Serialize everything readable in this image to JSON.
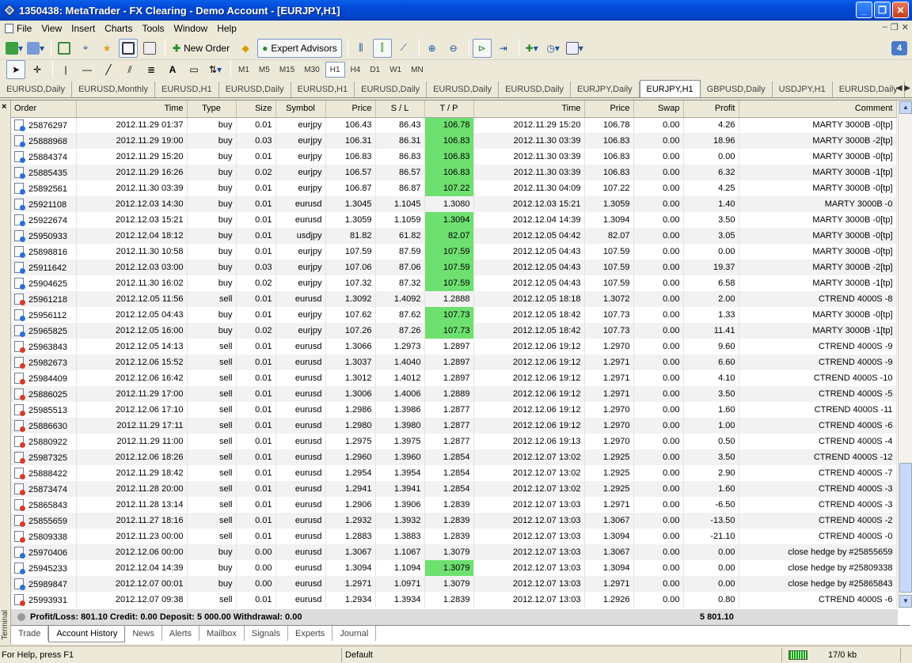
{
  "window": {
    "title": "1350438: MetaTrader - FX Clearing - Demo Account - [EURJPY,H1]"
  },
  "menu": [
    "File",
    "View",
    "Insert",
    "Charts",
    "Tools",
    "Window",
    "Help"
  ],
  "toolbar": {
    "new_order": "New Order",
    "expert_advisors": "Expert Advisors",
    "help_badge": "4"
  },
  "timeframes": [
    "M1",
    "M5",
    "M15",
    "M30",
    "H1",
    "H4",
    "D1",
    "W1",
    "MN"
  ],
  "active_timeframe": "H1",
  "chart_tabs": [
    "EURUSD,Daily",
    "EURUSD,Monthly",
    "EURUSD,H1",
    "EURUSD,Daily",
    "EURUSD,H1",
    "EURUSD,Daily",
    "EURUSD,Daily",
    "EURUSD,Daily",
    "EURJPY,Daily",
    "EURJPY,H1",
    "GBPUSD,Daily",
    "USDJPY,H1",
    "EURUSD,Daily"
  ],
  "active_chart_tab": "EURJPY,H1",
  "columns": [
    "Order",
    "Time",
    "Type",
    "Size",
    "Symbol",
    "Price",
    "S / L",
    "T / P",
    "Time",
    "Price",
    "Swap",
    "Profit",
    "Comment"
  ],
  "tp_highlight_color": "#6ee070",
  "rows": [
    [
      "25876297",
      "2012.11.29 01:37",
      "buy",
      "0.01",
      "eurjpy",
      "106.43",
      "86.43",
      "106.78",
      "2012.11.29 15:20",
      "106.78",
      "0.00",
      "4.26",
      "MARTY 3000B -0[tp]",
      1
    ],
    [
      "25888968",
      "2012.11.29 19:00",
      "buy",
      "0.03",
      "eurjpy",
      "106.31",
      "86.31",
      "106.83",
      "2012.11.30 03:39",
      "106.83",
      "0.00",
      "18.96",
      "MARTY 3000B -2[tp]",
      1
    ],
    [
      "25884374",
      "2012.11.29 15:20",
      "buy",
      "0.01",
      "eurjpy",
      "106.83",
      "86.83",
      "106.83",
      "2012.11.30 03:39",
      "106.83",
      "0.00",
      "0.00",
      "MARTY 3000B -0[tp]",
      1
    ],
    [
      "25885435",
      "2012.11.29 16:26",
      "buy",
      "0.02",
      "eurjpy",
      "106.57",
      "86.57",
      "106.83",
      "2012.11.30 03:39",
      "106.83",
      "0.00",
      "6.32",
      "MARTY 3000B -1[tp]",
      1
    ],
    [
      "25892561",
      "2012.11.30 03:39",
      "buy",
      "0.01",
      "eurjpy",
      "106.87",
      "86.87",
      "107.22",
      "2012.11.30 04:09",
      "107.22",
      "0.00",
      "4.25",
      "MARTY 3000B -0[tp]",
      1
    ],
    [
      "25921108",
      "2012.12.03 14:30",
      "buy",
      "0.01",
      "eurusd",
      "1.3045",
      "1.1045",
      "1.3080",
      "2012.12.03 15:21",
      "1.3059",
      "0.00",
      "1.40",
      "MARTY 3000B -0",
      0
    ],
    [
      "25922674",
      "2012.12.03 15:21",
      "buy",
      "0.01",
      "eurusd",
      "1.3059",
      "1.1059",
      "1.3094",
      "2012.12.04 14:39",
      "1.3094",
      "0.00",
      "3.50",
      "MARTY 3000B -0[tp]",
      1
    ],
    [
      "25950933",
      "2012.12.04 18:12",
      "buy",
      "0.01",
      "usdjpy",
      "81.82",
      "61.82",
      "82.07",
      "2012.12.05 04:42",
      "82.07",
      "0.00",
      "3.05",
      "MARTY 3000B -0[tp]",
      1
    ],
    [
      "25898816",
      "2012.11.30 10:58",
      "buy",
      "0.01",
      "eurjpy",
      "107.59",
      "87.59",
      "107.59",
      "2012.12.05 04:43",
      "107.59",
      "0.00",
      "0.00",
      "MARTY 3000B -0[tp]",
      1
    ],
    [
      "25911642",
      "2012.12.03 03:00",
      "buy",
      "0.03",
      "eurjpy",
      "107.06",
      "87.06",
      "107.59",
      "2012.12.05 04:43",
      "107.59",
      "0.00",
      "19.37",
      "MARTY 3000B -2[tp]",
      1
    ],
    [
      "25904625",
      "2012.11.30 16:02",
      "buy",
      "0.02",
      "eurjpy",
      "107.32",
      "87.32",
      "107.59",
      "2012.12.05 04:43",
      "107.59",
      "0.00",
      "6.58",
      "MARTY 3000B -1[tp]",
      1
    ],
    [
      "25961218",
      "2012.12.05 11:56",
      "sell",
      "0.01",
      "eurusd",
      "1.3092",
      "1.4092",
      "1.2888",
      "2012.12.05 18:18",
      "1.3072",
      "0.00",
      "2.00",
      "CTREND 4000S -8",
      0
    ],
    [
      "25956112",
      "2012.12.05 04:43",
      "buy",
      "0.01",
      "eurjpy",
      "107.62",
      "87.62",
      "107.73",
      "2012.12.05 18:42",
      "107.73",
      "0.00",
      "1.33",
      "MARTY 3000B -0[tp]",
      1
    ],
    [
      "25965825",
      "2012.12.05 16:00",
      "buy",
      "0.02",
      "eurjpy",
      "107.26",
      "87.26",
      "107.73",
      "2012.12.05 18:42",
      "107.73",
      "0.00",
      "11.41",
      "MARTY 3000B -1[tp]",
      1
    ],
    [
      "25963843",
      "2012.12.05 14:13",
      "sell",
      "0.01",
      "eurusd",
      "1.3066",
      "1.2973",
      "1.2897",
      "2012.12.06 19:12",
      "1.2970",
      "0.00",
      "9.60",
      "CTREND 4000S -9",
      0
    ],
    [
      "25982673",
      "2012.12.06 15:52",
      "sell",
      "0.01",
      "eurusd",
      "1.3037",
      "1.4040",
      "1.2897",
      "2012.12.06 19:12",
      "1.2971",
      "0.00",
      "6.60",
      "CTREND 4000S -9",
      0
    ],
    [
      "25984409",
      "2012.12.06 16:42",
      "sell",
      "0.01",
      "eurusd",
      "1.3012",
      "1.4012",
      "1.2897",
      "2012.12.06 19:12",
      "1.2971",
      "0.00",
      "4.10",
      "CTREND 4000S -10",
      0
    ],
    [
      "25886025",
      "2012.11.29 17:00",
      "sell",
      "0.01",
      "eurusd",
      "1.3006",
      "1.4006",
      "1.2889",
      "2012.12.06 19:12",
      "1.2971",
      "0.00",
      "3.50",
      "CTREND 4000S -5",
      0
    ],
    [
      "25985513",
      "2012.12.06 17:10",
      "sell",
      "0.01",
      "eurusd",
      "1.2986",
      "1.3986",
      "1.2877",
      "2012.12.06 19:12",
      "1.2970",
      "0.00",
      "1.60",
      "CTREND 4000S -11",
      0
    ],
    [
      "25886630",
      "2012.11.29 17:11",
      "sell",
      "0.01",
      "eurusd",
      "1.2980",
      "1.3980",
      "1.2877",
      "2012.12.06 19:12",
      "1.2970",
      "0.00",
      "1.00",
      "CTREND 4000S -6",
      0
    ],
    [
      "25880922",
      "2012.11.29 11:00",
      "sell",
      "0.01",
      "eurusd",
      "1.2975",
      "1.3975",
      "1.2877",
      "2012.12.06 19:13",
      "1.2970",
      "0.00",
      "0.50",
      "CTREND 4000S -4",
      0
    ],
    [
      "25987325",
      "2012.12.06 18:26",
      "sell",
      "0.01",
      "eurusd",
      "1.2960",
      "1.3960",
      "1.2854",
      "2012.12.07 13:02",
      "1.2925",
      "0.00",
      "3.50",
      "CTREND 4000S -12",
      0
    ],
    [
      "25888422",
      "2012.11.29 18:42",
      "sell",
      "0.01",
      "eurusd",
      "1.2954",
      "1.3954",
      "1.2854",
      "2012.12.07 13:02",
      "1.2925",
      "0.00",
      "2.90",
      "CTREND 4000S -7",
      0
    ],
    [
      "25873474",
      "2012.11.28 20:00",
      "sell",
      "0.01",
      "eurusd",
      "1.2941",
      "1.3941",
      "1.2854",
      "2012.12.07 13:02",
      "1.2925",
      "0.00",
      "1.60",
      "CTREND 4000S -3",
      0
    ],
    [
      "25865843",
      "2012.11.28 13:14",
      "sell",
      "0.01",
      "eurusd",
      "1.2906",
      "1.3906",
      "1.2839",
      "2012.12.07 13:03",
      "1.2971",
      "0.00",
      "-6.50",
      "CTREND 4000S -3",
      0
    ],
    [
      "25855659",
      "2012.11.27 18:16",
      "sell",
      "0.01",
      "eurusd",
      "1.2932",
      "1.3932",
      "1.2839",
      "2012.12.07 13:03",
      "1.3067",
      "0.00",
      "-13.50",
      "CTREND 4000S -2",
      0
    ],
    [
      "25809338",
      "2012.11.23 00:00",
      "sell",
      "0.01",
      "eurusd",
      "1.2883",
      "1.3883",
      "1.2839",
      "2012.12.07 13:03",
      "1.3094",
      "0.00",
      "-21.10",
      "CTREND 4000S -0",
      0
    ],
    [
      "25970406",
      "2012.12.06 00:00",
      "buy",
      "0.00",
      "eurusd",
      "1.3067",
      "1.1067",
      "1.3079",
      "2012.12.07 13:03",
      "1.3067",
      "0.00",
      "0.00",
      "close hedge by #25855659",
      0
    ],
    [
      "25945233",
      "2012.12.04 14:39",
      "buy",
      "0.00",
      "eurusd",
      "1.3094",
      "1.1094",
      "1.3079",
      "2012.12.07 13:03",
      "1.3094",
      "0.00",
      "0.00",
      "close hedge by #25809338",
      1
    ],
    [
      "25989847",
      "2012.12.07 00:01",
      "buy",
      "0.00",
      "eurusd",
      "1.2971",
      "1.0971",
      "1.3079",
      "2012.12.07 13:03",
      "1.2971",
      "0.00",
      "0.00",
      "close hedge by #25865843",
      0
    ],
    [
      "25993931",
      "2012.12.07 09:38",
      "sell",
      "0.01",
      "eurusd",
      "1.2934",
      "1.3934",
      "1.2839",
      "2012.12.07 13:03",
      "1.2926",
      "0.00",
      "0.80",
      "CTREND 4000S -6",
      0
    ]
  ],
  "summary": {
    "text": "Profit/Loss: 801.10  Credit: 0.00  Deposit: 5 000.00  Withdrawal: 0.00",
    "balance": "5 801.10"
  },
  "terminal": {
    "side_label": "Terminal",
    "close": "×"
  },
  "terminal_tabs": [
    "Trade",
    "Account History",
    "News",
    "Alerts",
    "Mailbox",
    "Signals",
    "Experts",
    "Journal"
  ],
  "active_terminal_tab": "Account History",
  "status": {
    "help": "For Help, press F1",
    "profile": "Default",
    "traffic": "17/0 kb"
  }
}
